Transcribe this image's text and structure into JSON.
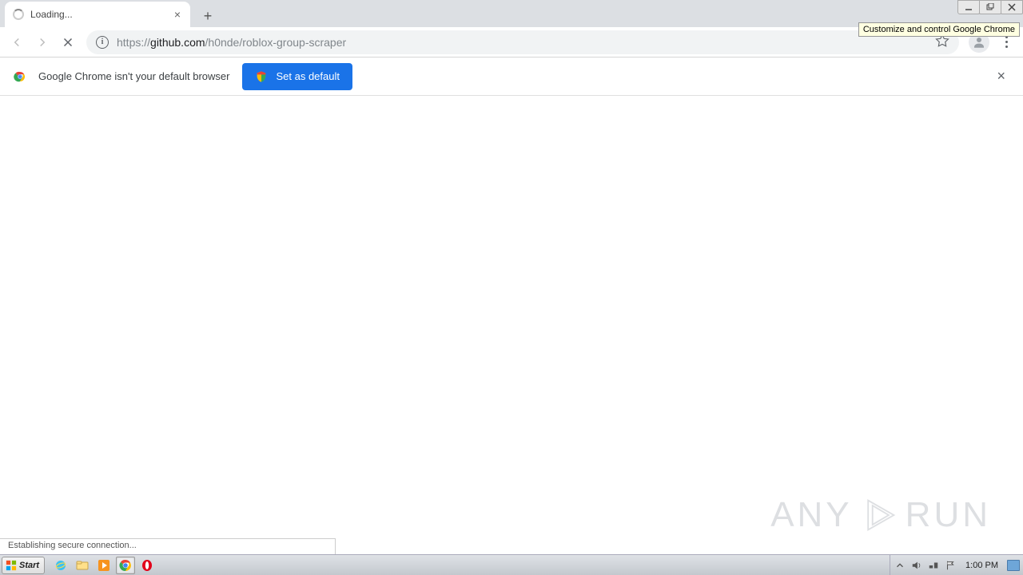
{
  "window": {
    "tooltip": "Customize and control Google Chrome"
  },
  "tab": {
    "title": "Loading..."
  },
  "addressbar": {
    "scheme": "https://",
    "host": "github.com",
    "path": "/h0nde/roblox-group-scraper"
  },
  "infobar": {
    "message": "Google Chrome isn't your default browser",
    "button_label": "Set as default"
  },
  "status": {
    "text": "Establishing secure connection..."
  },
  "watermark": {
    "left": "ANY",
    "right": "RUN"
  },
  "taskbar": {
    "start_label": "Start",
    "clock": "1:00 PM"
  }
}
